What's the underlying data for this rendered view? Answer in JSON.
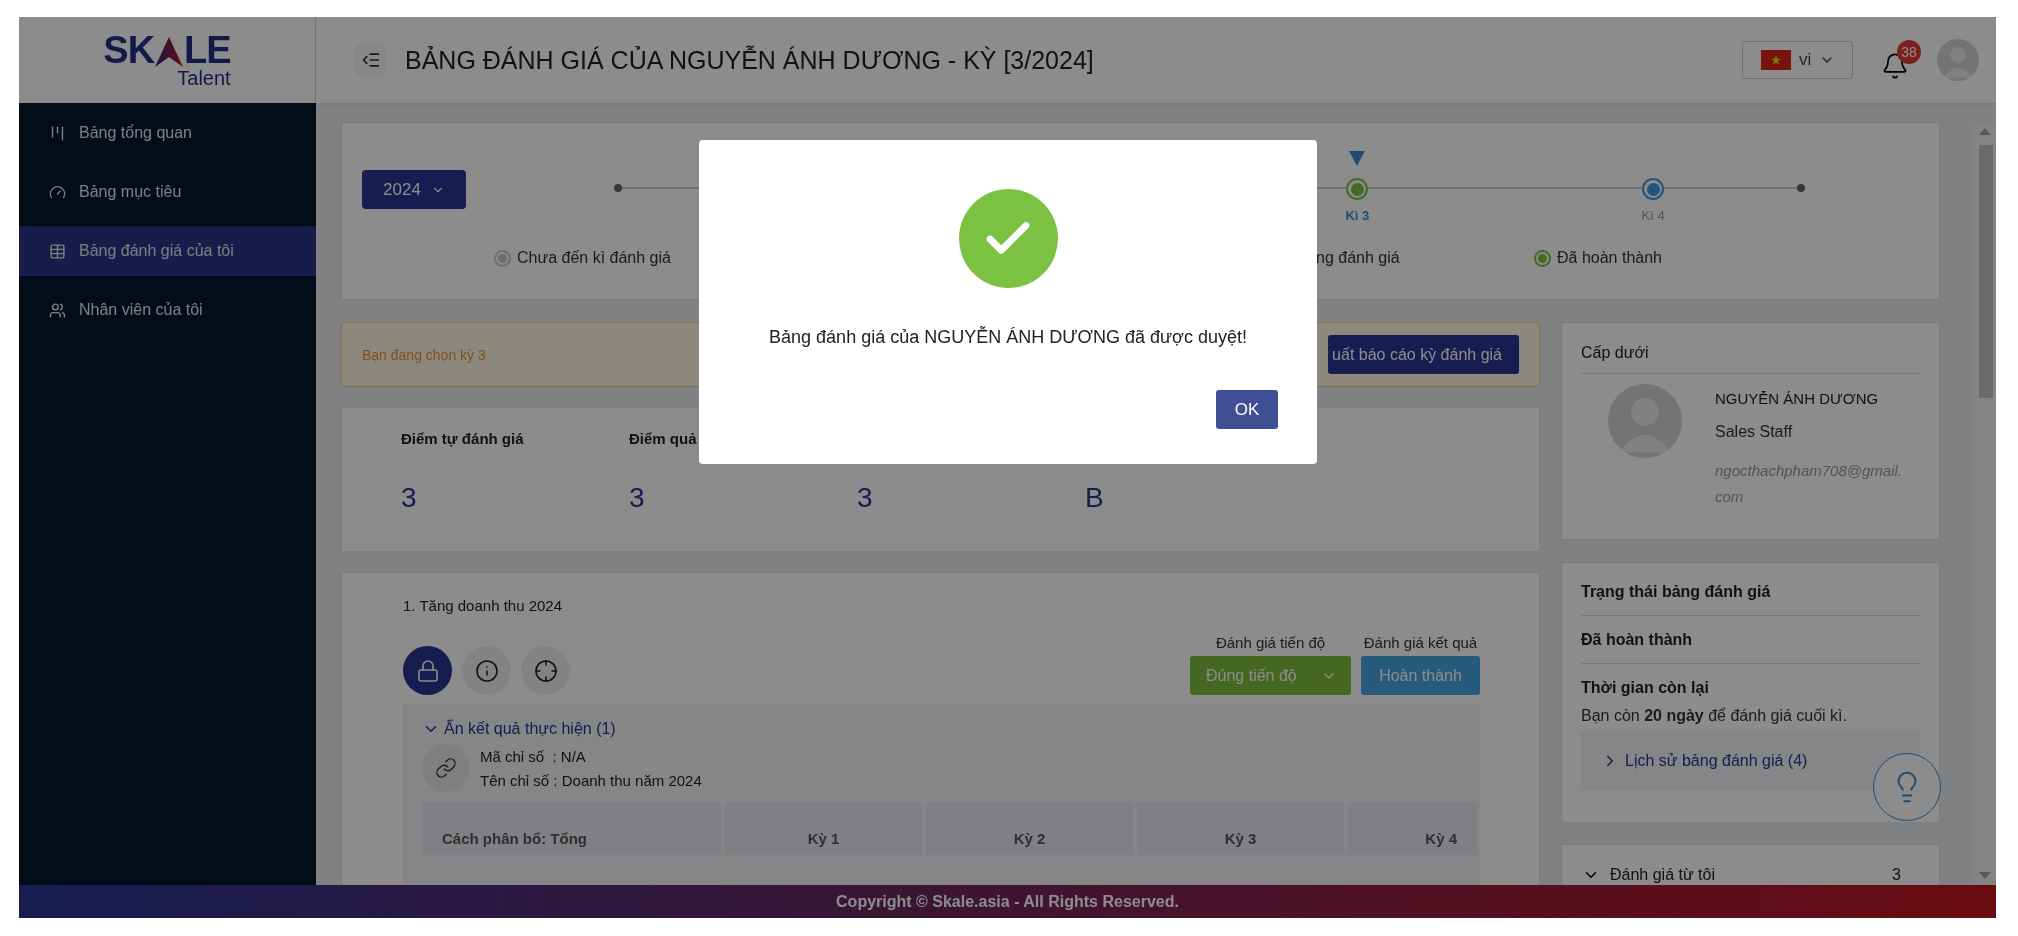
{
  "logo": {
    "left": "SK",
    "right": "LE",
    "tagline": "Talent"
  },
  "header": {
    "title": "BẢNG ĐÁNH GIÁ CỦA NGUYỄN ÁNH DƯƠNG - KỲ [3/2024]",
    "language": "vi",
    "notifications": "38"
  },
  "sidebar": {
    "items": [
      {
        "label": "Bảng tổng quan",
        "kind": "overview",
        "selected": false
      },
      {
        "label": "Bảng mục tiêu",
        "kind": "goals",
        "selected": false
      },
      {
        "label": "Bảng đánh giá của tôi",
        "kind": "reviews",
        "selected": true
      },
      {
        "label": "Nhân viên của tôi",
        "kind": "staff",
        "selected": false
      }
    ]
  },
  "timeline": {
    "year": "2024",
    "periods": [
      {
        "label": "Kì 3",
        "kind": "done",
        "selected": true
      },
      {
        "label": "Kì 4",
        "kind": "upcoming",
        "selected": false
      }
    ],
    "legend": [
      {
        "label": "Chưa đến kì đánh giá",
        "color": "#6e6e6e"
      },
      {
        "label": "ng đánh giá"
      },
      {
        "label": "Đã hoàn thành",
        "color": "#446b24"
      }
    ]
  },
  "notice": {
    "text": "Bạn đang chọn kỳ 3",
    "button": "uất báo cáo kỳ đánh giá"
  },
  "stats": [
    {
      "label": "Điểm tự đánh giá",
      "value": "3"
    },
    {
      "label": "Điểm quả",
      "value": "3"
    },
    {
      "value": "3"
    },
    {
      "value": "B"
    }
  ],
  "objective": {
    "title": "1. Tăng doanh thu 2024",
    "tools": [
      {
        "kind": "lock",
        "selected": true
      },
      {
        "kind": "info",
        "selected": false
      },
      {
        "kind": "target",
        "selected": false
      }
    ],
    "progress_label": "Đánh giá tiến độ",
    "progress_value": "Đúng tiến độ",
    "result_label": "Đánh giá kết quả",
    "result_value": "Hoàn thành",
    "toggle": {
      "label": "Ẩn kết quả thực hiện (1)",
      "expanded": true
    },
    "indicator_code": "Mã chỉ số  : N/A",
    "indicator_name": "Tên chỉ số : Doanh thu năm 2024",
    "table_columns": [
      "Cách phân bổ: Tổng",
      "Kỳ 1",
      "Kỳ 2",
      "Kỳ 3",
      "Kỳ 4"
    ]
  },
  "subordinate": {
    "title": "Cấp dưới",
    "name": "NGUYỄN ÁNH DƯƠNG",
    "role": "Sales Staff",
    "email": "ngocthachpham708@gmail.com"
  },
  "status": {
    "title": "Trạng thái bảng đánh giá",
    "value": "Đã hoàn thành",
    "remaining_title": "Thời gian còn lại",
    "remaining_text": "Bạn còn **20 ngày** để đánh giá cuối kì.",
    "history": {
      "label": "Lịch sử bảng đánh giá (4)",
      "expanded": false
    }
  },
  "my_reviews": {
    "label": "Đánh giá từ tôi",
    "count": "3"
  },
  "modal": {
    "message": "Bảng đánh giá của NGUYỄN ÁNH DƯƠNG đã được duyệt!",
    "ok": "OK"
  },
  "footer": "Copyright © Skale.asia - All Rights Reserved."
}
